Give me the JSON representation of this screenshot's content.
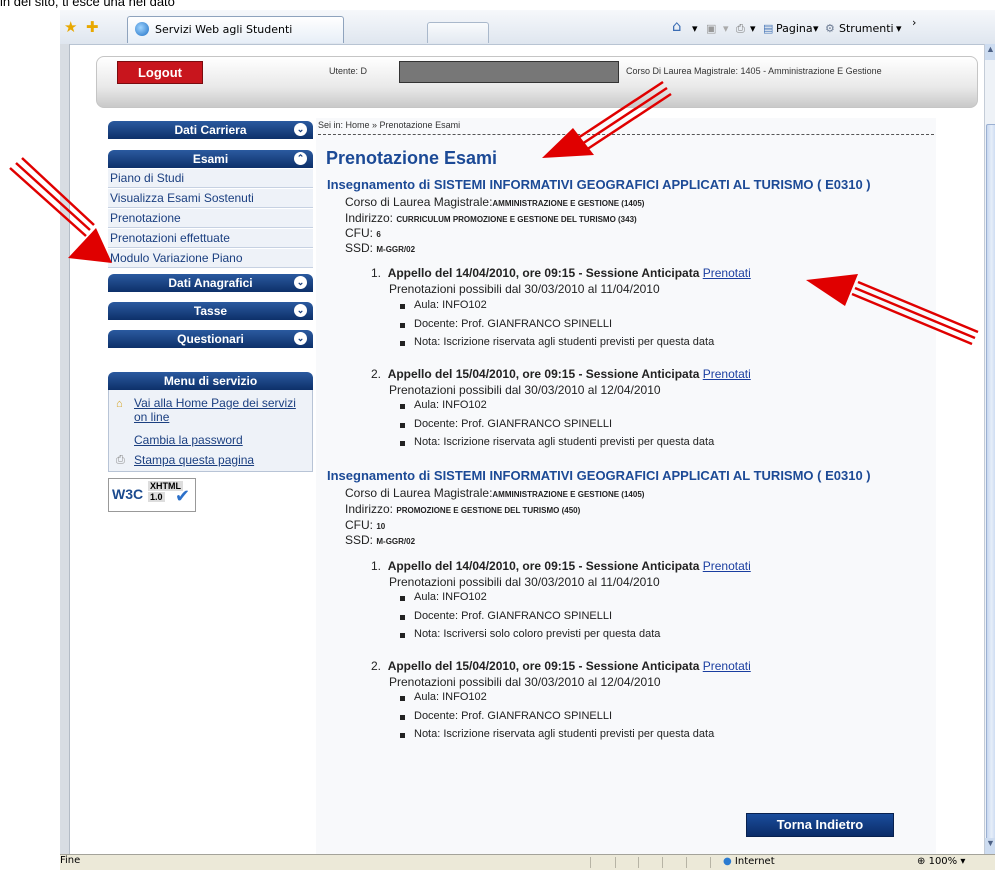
{
  "top_strip_text": "in del sito, ti esce una nel  dato",
  "browser": {
    "tab_title": "Servizi Web agli Studenti",
    "toolbar": {
      "home_icon": "home-icon",
      "feeds_icon": "feeds-icon",
      "print_icon": "print-icon",
      "page_label": "Pagina",
      "tools_label": "Strumenti"
    }
  },
  "header": {
    "logout_label": "Logout",
    "user_label": "Utente: D",
    "course_label": "Corso Di Laurea Magistrale: 1405 - Amministrazione E Gestione"
  },
  "sidebar": {
    "sections": [
      {
        "label": "Dati Carriera"
      },
      {
        "label": "Esami",
        "items": [
          "Piano di Studi",
          "Visualizza Esami Sostenuti",
          "Prenotazione",
          "Prenotazioni effettuate",
          "Modulo Variazione Piano"
        ]
      },
      {
        "label": "Dati Anagrafici"
      },
      {
        "label": "Tasse"
      },
      {
        "label": "Questionari"
      }
    ],
    "service_menu": {
      "title": "Menu di servizio",
      "home_link_line1": "Vai alla Home Page dei servizi",
      "home_link_line2": "on line",
      "password_link": "Cambia la password",
      "print_link": "Stampa questa pagina"
    },
    "w3c_badge": {
      "left": "W3C",
      "top": "XHTML",
      "bottom": "1.0"
    }
  },
  "main": {
    "breadcrumb": "Sei in: Home » Prenotazione Esami",
    "page_title": "Prenotazione Esami",
    "courses": [
      {
        "title": "Insegnamento di SISTEMI INFORMATIVI GEOGRAFICI APPLICATI AL TURISMO ( E0310 )",
        "corso_label": "Corso di Laurea Magistrale:",
        "corso_value": "AMMINISTRAZIONE E GESTIONE (1405)",
        "indirizzo_label": "Indirizzo:",
        "indirizzo_value": "CURRICULUM PROMOZIONE E GESTIONE DEL TURISMO (343)",
        "cfu_label": "CFU:",
        "cfu_value": "6",
        "ssd_label": "SSD:",
        "ssd_value": "M-GGR/02",
        "appelli": [
          {
            "num": "1.",
            "title": "Appello del 14/04/2010, ore 09:15",
            "session": " - Sessione Anticipata",
            "link": "Prenotati",
            "window": "Prenotazioni possibili dal 30/03/2010 al 11/04/2010",
            "aula": "Aula: INFO102",
            "docente": "Docente: Prof. GIANFRANCO SPINELLI",
            "nota": "Nota: Iscrizione riservata agli studenti previsti per questa data"
          },
          {
            "num": "2.",
            "title": "Appello del 15/04/2010, ore 09:15",
            "session": " - Sessione Anticipata",
            "link": "Prenotati",
            "window": "Prenotazioni possibili dal 30/03/2010 al 12/04/2010",
            "aula": "Aula: INFO102",
            "docente": "Docente: Prof. GIANFRANCO SPINELLI",
            "nota": "Nota: Iscrizione riservata agli studenti previsti per questa data"
          }
        ]
      },
      {
        "title": "Insegnamento di SISTEMI INFORMATIVI GEOGRAFICI APPLICATI AL TURISMO ( E0310 )",
        "corso_label": "Corso di Laurea Magistrale:",
        "corso_value": "AMMINISTRAZIONE E GESTIONE (1405)",
        "indirizzo_label": "Indirizzo:",
        "indirizzo_value": "PROMOZIONE E GESTIONE DEL TURISMO (450)",
        "cfu_label": "CFU:",
        "cfu_value": "10",
        "ssd_label": "SSD:",
        "ssd_value": "M-GGR/02",
        "appelli": [
          {
            "num": "1.",
            "title": "Appello del 14/04/2010, ore 09:15",
            "session": " - Sessione Anticipata",
            "link": "Prenotati",
            "window": "Prenotazioni possibili dal 30/03/2010 al 11/04/2010",
            "aula": "Aula: INFO102",
            "docente": "Docente: Prof. GIANFRANCO SPINELLI",
            "nota": "Nota: Iscriversi solo coloro previsti per questa data"
          },
          {
            "num": "2.",
            "title": "Appello del 15/04/2010, ore 09:15",
            "session": " - Sessione Anticipata",
            "link": "Prenotati",
            "window": "Prenotazioni possibili dal 30/03/2010 al 12/04/2010",
            "aula": "Aula: INFO102",
            "docente": "Docente: Prof. GIANFRANCO SPINELLI",
            "nota": "Nota: Iscrizione riservata agli studenti previsti per questa data"
          }
        ]
      }
    ],
    "back_button": "Torna Indietro"
  },
  "statusbar": {
    "left": "Fine",
    "zone": "Internet",
    "zoom": "100%"
  },
  "colors": {
    "menu_blue": "#0d3069",
    "title_blue": "#1c4a96",
    "logout_red": "#c8151d",
    "annotation_red": "#e00000"
  }
}
